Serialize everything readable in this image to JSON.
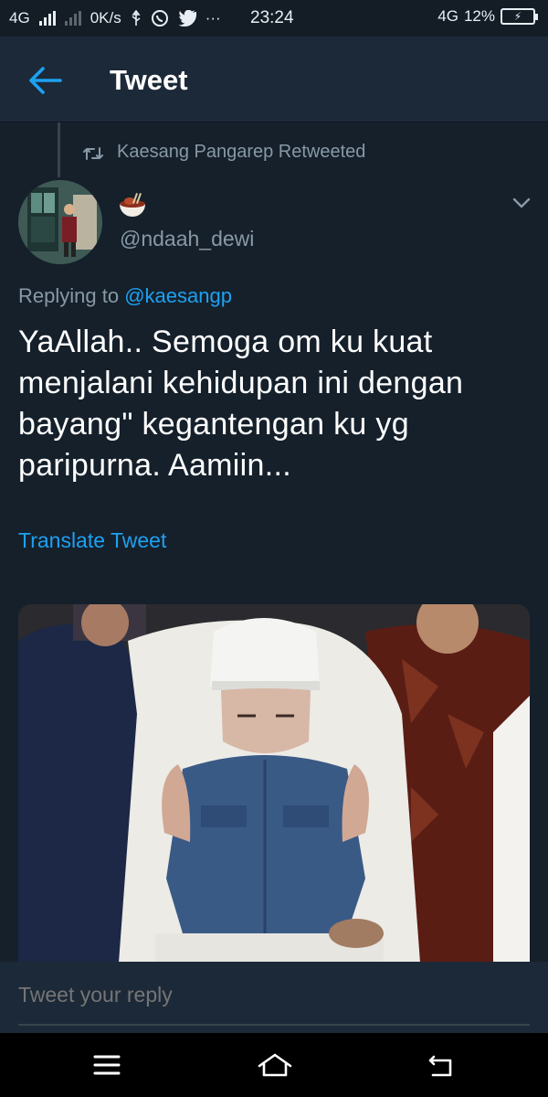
{
  "status_bar": {
    "network_left": "4G",
    "speed": "0K/s",
    "dots": "···",
    "time": "23:24",
    "network_right": "4G",
    "battery": "12%"
  },
  "header": {
    "title": "Tweet",
    "back_icon": "arrow-left-icon"
  },
  "retweet": {
    "icon": "retweet-icon",
    "text": "Kaesang Pangarep Retweeted"
  },
  "author": {
    "display_name_icon": "bowl-emoji",
    "handle": "@ndaah_dewi"
  },
  "tweet": {
    "replying_prefix": "Replying to",
    "replying_mention": "@kaesangp",
    "lines": [
      "YaAllah.. Semoga om ku kuat",
      "menjalani kehidupan ini dengan",
      "bayang\" kegantengan ku yg",
      "paripurna. Aamiin..."
    ],
    "translate_label": "Translate Tweet"
  },
  "reply": {
    "placeholder": "Tweet your reply"
  },
  "colors": {
    "background": "#15202b",
    "header": "#1c2938",
    "accent": "#1da1f2",
    "muted": "#8899a6"
  }
}
